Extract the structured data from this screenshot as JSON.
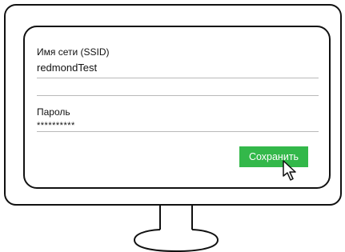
{
  "form": {
    "ssid_label": "Имя сети (SSID)",
    "ssid_value": "redmondTest",
    "password_label": "Пароль",
    "password_value": "**********",
    "save_label": "Сохранить"
  },
  "icons": {
    "cursor": "mouse-pointer-icon"
  },
  "colors": {
    "accent": "#33b84a",
    "outline": "#111111",
    "field_line": "#b9b9b9",
    "background": "#ffffff"
  }
}
